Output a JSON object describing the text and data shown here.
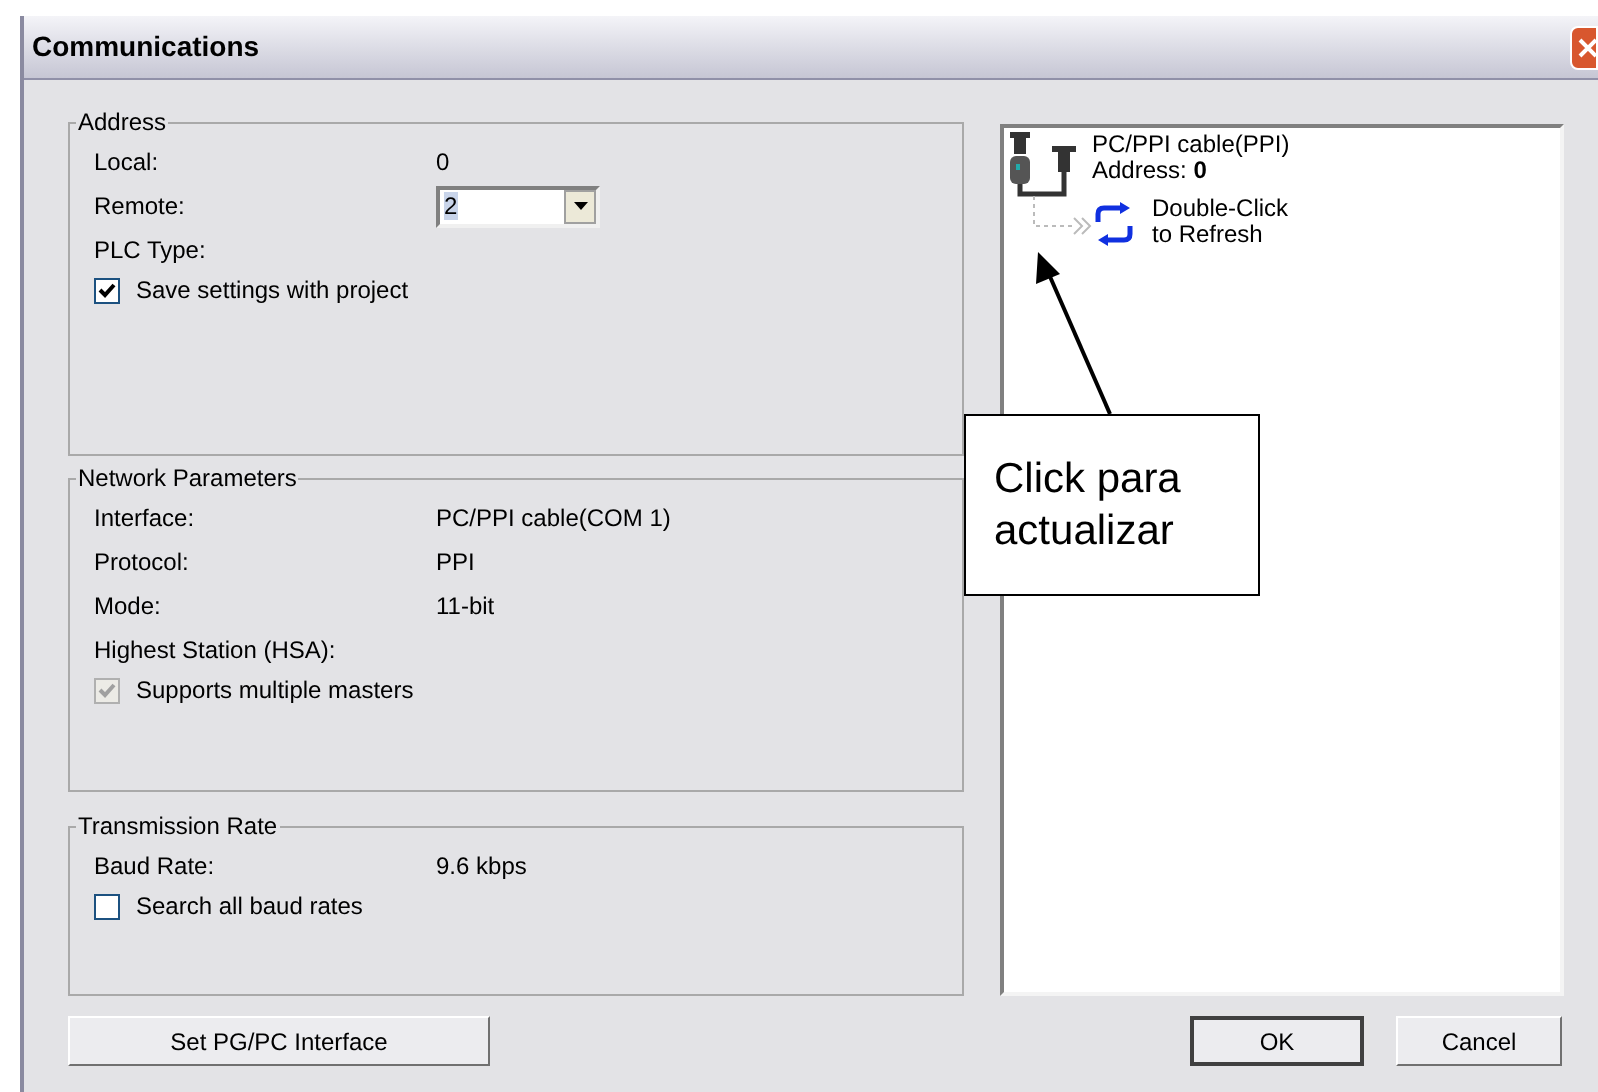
{
  "window": {
    "title": "Communications"
  },
  "groups": [
    {
      "title": "Address",
      "rows": [
        {
          "kind": "text",
          "label": "Local:",
          "value": "0"
        },
        {
          "kind": "dropdown",
          "label": "Remote:",
          "value": "2"
        },
        {
          "kind": "label",
          "label": "PLC Type:"
        }
      ],
      "checkbox": {
        "label": "Save settings with project",
        "checked": true,
        "disabled": false
      }
    },
    {
      "title": "Network Parameters",
      "rows": [
        {
          "kind": "text",
          "label": "Interface:",
          "value": "PC/PPI cable(COM 1)"
        },
        {
          "kind": "text",
          "label": "Protocol:",
          "value": "PPI"
        },
        {
          "kind": "text",
          "label": "Mode:",
          "value": "11-bit"
        },
        {
          "kind": "label",
          "label": "Highest Station (HSA):"
        }
      ],
      "checkbox": {
        "label": "Supports multiple masters",
        "checked": true,
        "disabled": true
      }
    },
    {
      "title": "Transmission Rate",
      "rows": [
        {
          "kind": "text",
          "label": "Baud Rate:",
          "value": "9.6 kbps"
        }
      ],
      "checkbox": {
        "label": "Search all baud rates",
        "checked": false,
        "disabled": false
      }
    }
  ],
  "device_panel": {
    "device": "PC/PPI cable(PPI)",
    "address": "Address: **0**",
    "refresh": "Double-Click\nto Refresh"
  },
  "buttons": {
    "interface": "Set PG/PC Interface",
    "ok": "OK",
    "cancel": "Cancel"
  },
  "callout": {
    "text": "Click para\nactualizar"
  }
}
